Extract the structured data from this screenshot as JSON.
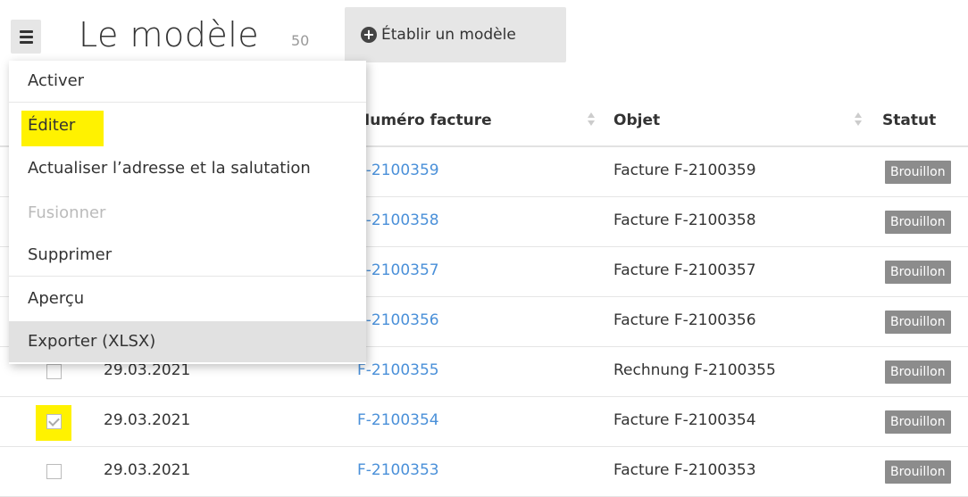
{
  "header": {
    "title": "Le modèle",
    "count": "50",
    "create_button": "Établir un modèle"
  },
  "menu": {
    "items": [
      {
        "label": "Activer",
        "enabled": true
      },
      {
        "label": "Éditer",
        "enabled": true,
        "highlighted": true
      },
      {
        "label": "Actualiser l’adresse et la salutation",
        "enabled": true
      },
      {
        "label": "Fusionner",
        "enabled": false
      },
      {
        "label": "Supprimer",
        "enabled": true
      },
      {
        "label": "Aperçu",
        "enabled": true
      },
      {
        "label": "Exporter (XLSX)",
        "enabled": true,
        "hovered": true
      }
    ]
  },
  "table": {
    "columns": {
      "number": "Numéro facture",
      "subject": "Objet",
      "status": "Statut"
    },
    "rows": [
      {
        "date": "",
        "number": "F-2100359",
        "subject": "Facture F-2100359",
        "status": "Brouillon",
        "checked": false
      },
      {
        "date": "",
        "number": "F-2100358",
        "subject": "Facture F-2100358",
        "status": "Brouillon",
        "checked": false
      },
      {
        "date": "",
        "number": "F-2100357",
        "subject": "Facture F-2100357",
        "status": "Brouillon",
        "checked": false
      },
      {
        "date": "",
        "number": "F-2100356",
        "subject": "Facture F-2100356",
        "status": "Brouillon",
        "checked": false
      },
      {
        "date": "29.03.2021",
        "number": "F-2100355",
        "subject": "Rechnung F-2100355",
        "status": "Brouillon",
        "checked": false
      },
      {
        "date": "29.03.2021",
        "number": "F-2100354",
        "subject": "Facture F-2100354",
        "status": "Brouillon",
        "checked": true
      },
      {
        "date": "29.03.2021",
        "number": "F-2100353",
        "subject": "Facture F-2100353",
        "status": "Brouillon",
        "checked": false
      }
    ]
  },
  "colors": {
    "highlight": "#fff200",
    "link": "#4a90d9",
    "badge": "#8c8c8c"
  }
}
